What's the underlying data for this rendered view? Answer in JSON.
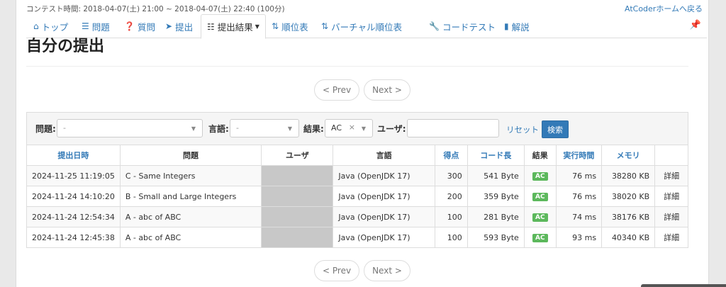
{
  "header": {
    "contest_time": "コンテスト時間: 2018-04-07(土) 21:00 ~ 2018-04-07(土) 22:40 (100分)",
    "home_link": "AtCoderホームへ戻る"
  },
  "nav": {
    "items": [
      {
        "label": "トップ",
        "icon": "home-icon"
      },
      {
        "label": "問題",
        "icon": "list-icon"
      },
      {
        "label": "質問",
        "icon": "question-icon"
      },
      {
        "label": "提出",
        "icon": "send-icon"
      },
      {
        "label": "提出結果",
        "icon": "table-icon"
      },
      {
        "label": "順位表",
        "icon": "sort-icon"
      },
      {
        "label": "バーチャル順位表",
        "icon": "sort-icon"
      },
      {
        "label": "コードテスト",
        "icon": "wrench-icon"
      },
      {
        "label": "解説",
        "icon": "book-icon"
      }
    ],
    "active_index": 4
  },
  "page": {
    "title": "自分の提出"
  },
  "pager": {
    "prev": "< Prev",
    "next": "Next >"
  },
  "filter": {
    "problem_label": "問題:",
    "problem_value": "-",
    "language_label": "言語:",
    "language_value": "-",
    "result_label": "結果:",
    "result_value": "AC",
    "user_label": "ユーザ:",
    "user_value": "",
    "reset": "リセット",
    "search": "検索"
  },
  "table": {
    "headers": [
      "提出日時",
      "問題",
      "ユーザ",
      "言語",
      "得点",
      "コード長",
      "結果",
      "実行時間",
      "メモリ",
      ""
    ],
    "detail_label": "詳細",
    "rows": [
      {
        "date": "2024-11-25 11:19:05",
        "problem": "C - Same Integers",
        "user": "",
        "lang": "Java (OpenJDK 17)",
        "score": "300",
        "code_len": "541 Byte",
        "result": "AC",
        "time": "76 ms",
        "memory": "38280 KB"
      },
      {
        "date": "2024-11-24 14:10:20",
        "problem": "B - Small and Large Integers",
        "user": "",
        "lang": "Java (OpenJDK 17)",
        "score": "200",
        "code_len": "359 Byte",
        "result": "AC",
        "time": "76 ms",
        "memory": "38020 KB"
      },
      {
        "date": "2024-11-24 12:54:34",
        "problem": "A - abc of ABC",
        "user": "",
        "lang": "Java (OpenJDK 17)",
        "score": "100",
        "code_len": "281 Byte",
        "result": "AC",
        "time": "74 ms",
        "memory": "38176 KB"
      },
      {
        "date": "2024-11-24 12:45:38",
        "problem": "A - abc of ABC",
        "user": "",
        "lang": "Java (OpenJDK 17)",
        "score": "100",
        "code_len": "593 Byte",
        "result": "AC",
        "time": "93 ms",
        "memory": "40340 KB"
      }
    ]
  },
  "colors": {
    "link": "#337ab7",
    "ac_badge": "#5cb85c",
    "primary_button": "#337ab7"
  }
}
